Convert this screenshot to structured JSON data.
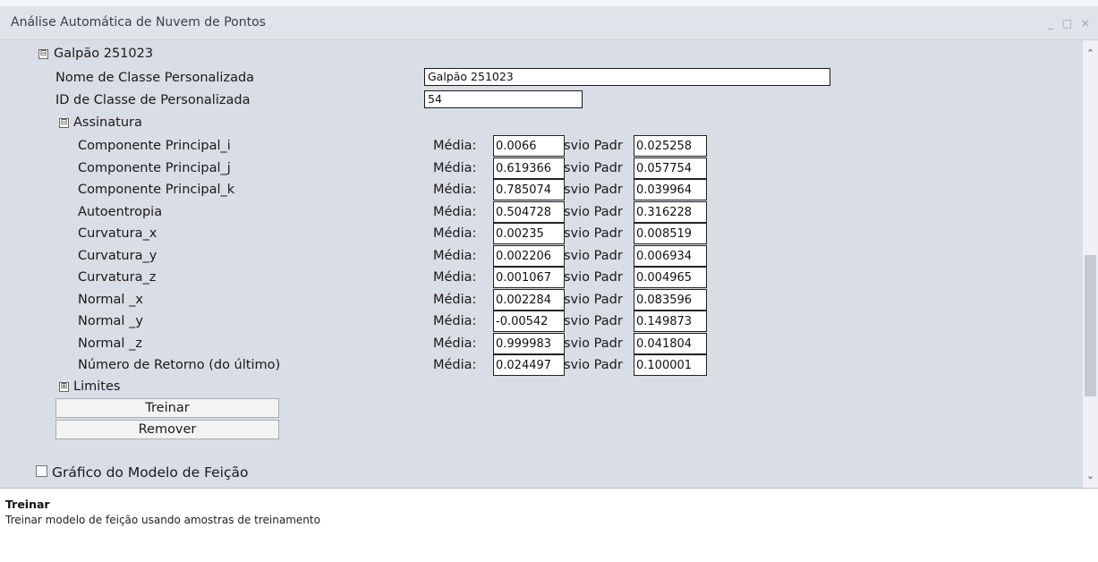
{
  "window": {
    "title": "Análise Automática de Nuvem de Pontos",
    "buttons": "_ □ ×"
  },
  "tree": {
    "root_label": "Galpão 251023",
    "root_toggle": "⊟",
    "class_name_label": "Nome de Classe Personalizada",
    "class_name_value": "Galpão 251023",
    "class_id_label": "ID de Classe de Personalizada",
    "class_id_value": "54",
    "signature_toggle": "⊟",
    "signature_label": "Assinatura",
    "mean_label": "Média:",
    "std_label": "svio Padr",
    "rows": [
      {
        "name": "Componente Principal_i",
        "mean": "0.0066",
        "std": "0.025258"
      },
      {
        "name": "Componente Principal_j",
        "mean": "0.619366",
        "std": "0.057754"
      },
      {
        "name": "Componente Principal_k",
        "mean": "0.785074",
        "std": "0.039964"
      },
      {
        "name": "Autoentropia",
        "mean": "0.504728",
        "std": "0.316228"
      },
      {
        "name": "Curvatura_x",
        "mean": "0.00235",
        "std": "0.008519"
      },
      {
        "name": "Curvatura_y",
        "mean": "0.002206",
        "std": "0.006934"
      },
      {
        "name": "Curvatura_z",
        "mean": "0.001067",
        "std": "0.004965"
      },
      {
        "name": "Normal _x",
        "mean": "0.002284",
        "std": "0.083596"
      },
      {
        "name": "Normal _y",
        "mean": "-0.00542",
        "std": "0.149873"
      },
      {
        "name": "Normal _z",
        "mean": "0.999983",
        "std": "0.041804"
      },
      {
        "name": "Número de Retorno (do último)",
        "mean": "0.024497",
        "std": "0.100001"
      }
    ],
    "limits_toggle": "⊞",
    "limits_label": "Limites",
    "train_button": "Treinar",
    "remove_button": "Remover",
    "model_chart_label": "Gráfico do Modelo de Feição"
  },
  "scrollbar": {
    "up": "⌃",
    "down": "⌄"
  },
  "description": {
    "title": "Treinar",
    "text": "Treinar modelo de feição usando amostras de treinamento"
  }
}
